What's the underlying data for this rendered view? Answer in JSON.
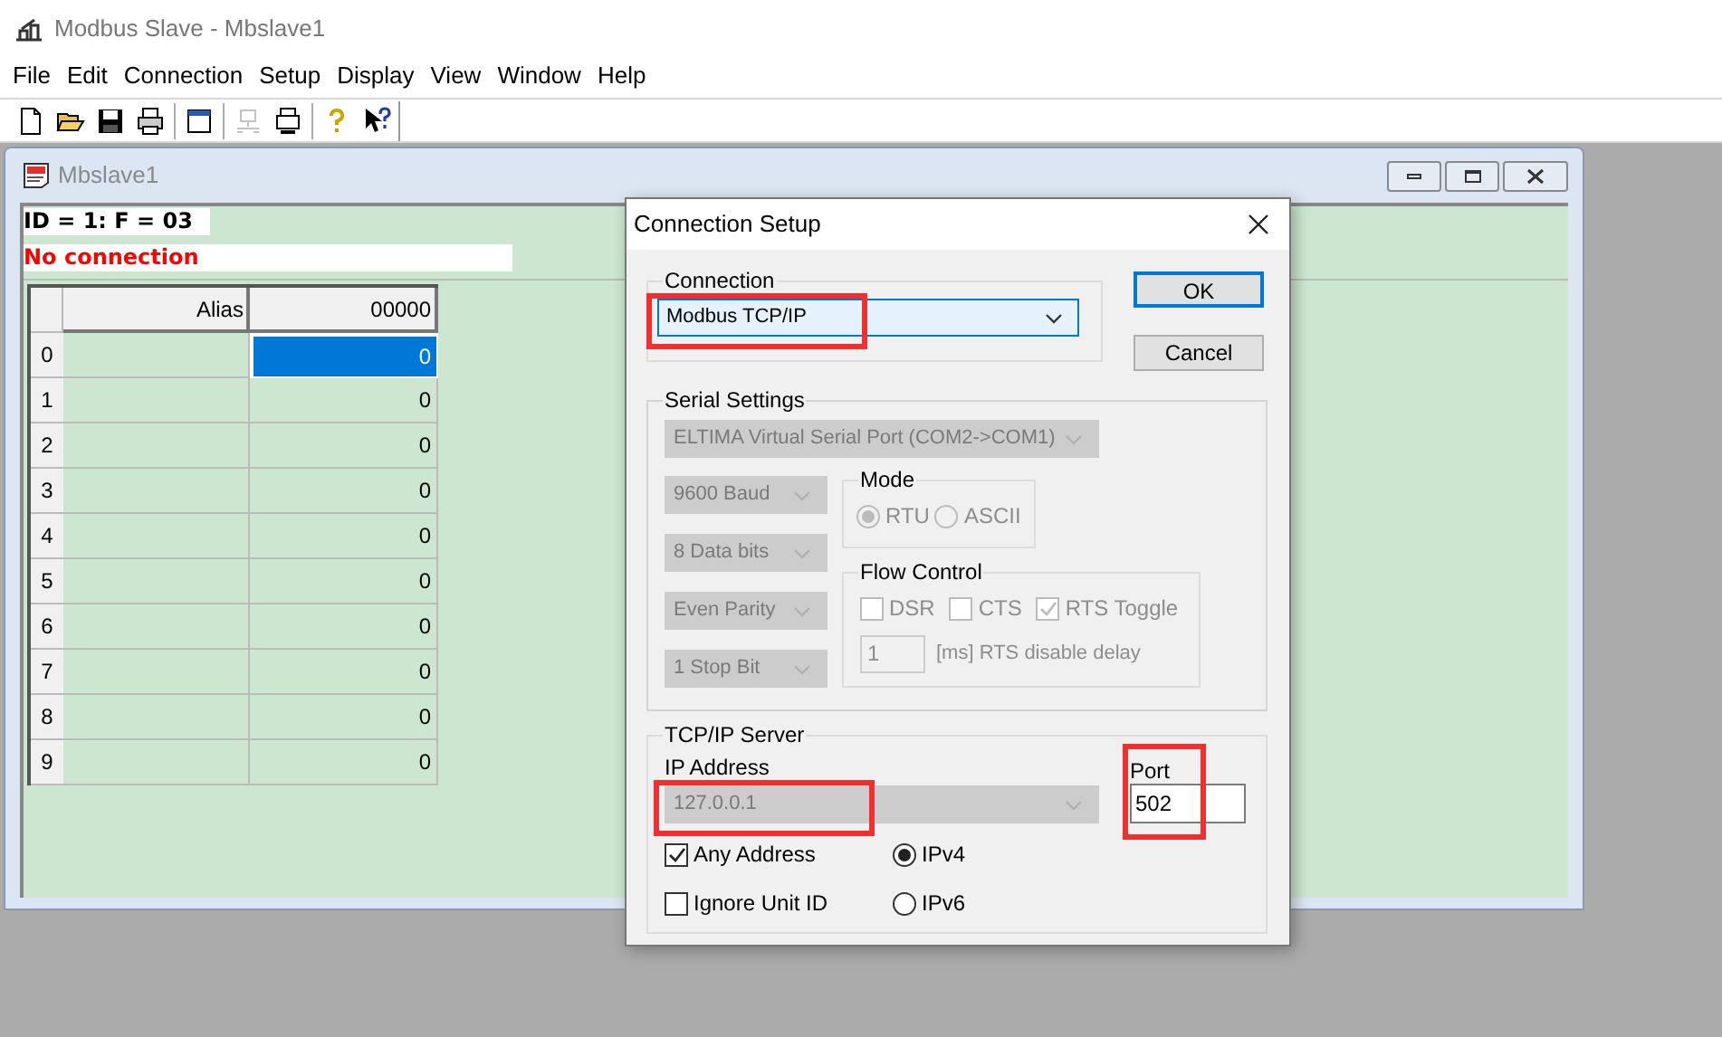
{
  "window": {
    "title": "Modbus Slave - Mbslave1"
  },
  "menu": [
    "File",
    "Edit",
    "Connection",
    "Setup",
    "Display",
    "View",
    "Window",
    "Help"
  ],
  "toolbar": [
    {
      "kind": "new",
      "disabled": false
    },
    {
      "kind": "open",
      "disabled": false
    },
    {
      "kind": "save",
      "disabled": false
    },
    {
      "kind": "print",
      "disabled": false
    },
    {
      "kind": "sep"
    },
    {
      "kind": "window",
      "disabled": false
    },
    {
      "kind": "sep"
    },
    {
      "kind": "network",
      "disabled": true
    },
    {
      "kind": "device",
      "disabled": false
    },
    {
      "kind": "sep"
    },
    {
      "kind": "help",
      "disabled": false
    },
    {
      "kind": "whatsthis",
      "disabled": false
    }
  ],
  "child": {
    "title": "Mbslave1",
    "id_line": "ID = 1: F = 03",
    "status": "No connection",
    "columns": [
      "Alias",
      "00000"
    ],
    "rows": [
      {
        "index": "0",
        "alias": "",
        "value": "0",
        "selected": true
      },
      {
        "index": "1",
        "alias": "",
        "value": "0",
        "selected": false
      },
      {
        "index": "2",
        "alias": "",
        "value": "0",
        "selected": false
      },
      {
        "index": "3",
        "alias": "",
        "value": "0",
        "selected": false
      },
      {
        "index": "4",
        "alias": "",
        "value": "0",
        "selected": false
      },
      {
        "index": "5",
        "alias": "",
        "value": "0",
        "selected": false
      },
      {
        "index": "6",
        "alias": "",
        "value": "0",
        "selected": false
      },
      {
        "index": "7",
        "alias": "",
        "value": "0",
        "selected": false
      },
      {
        "index": "8",
        "alias": "",
        "value": "0",
        "selected": false
      },
      {
        "index": "9",
        "alias": "",
        "value": "0",
        "selected": false
      }
    ]
  },
  "dialog": {
    "title": "Connection Setup",
    "connection": {
      "label": "Connection",
      "value": "Modbus TCP/IP",
      "highlighted": true
    },
    "buttons": [
      {
        "label": "OK",
        "default": true
      },
      {
        "label": "Cancel",
        "default": false
      }
    ],
    "serial": {
      "label": "Serial Settings",
      "disabled": true,
      "port": "ELTIMA Virtual Serial Port (COM2->COM1)",
      "baud": "9600 Baud",
      "data_bits": "8 Data bits",
      "parity": "Even Parity",
      "stop_bits": "1 Stop Bit",
      "mode": {
        "label": "Mode",
        "options": [
          {
            "label": "RTU",
            "selected": true
          },
          {
            "label": "ASCII",
            "selected": false
          }
        ]
      },
      "flow": {
        "label": "Flow Control",
        "checks": [
          {
            "label": "DSR",
            "checked": false
          },
          {
            "label": "CTS",
            "checked": false
          },
          {
            "label": "RTS Toggle",
            "checked": true
          }
        ],
        "delay": "1",
        "delay_label": "[ms] RTS disable delay"
      }
    },
    "tcp": {
      "label": "TCP/IP Server",
      "ip_label": "IP Address",
      "ip": "127.0.0.1",
      "ip_disabled": true,
      "ip_highlighted": true,
      "port_label": "Port",
      "port": "502",
      "port_highlighted": true,
      "checks": [
        {
          "label": "Any Address",
          "checked": true
        },
        {
          "label": "Ignore Unit ID",
          "checked": false
        }
      ],
      "ip_versions": [
        {
          "label": "IPv4",
          "selected": true
        },
        {
          "label": "IPv6",
          "selected": false
        }
      ]
    }
  }
}
